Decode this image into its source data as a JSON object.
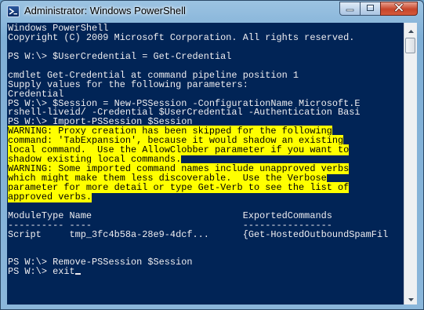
{
  "window": {
    "title": "Administrator: Windows PowerShell",
    "icon": "powershell-icon",
    "buttons": [
      "minimize-icon",
      "maximize-icon",
      "close-icon"
    ]
  },
  "colors": {
    "console_background": "#012456",
    "console_text": "#eeedf0",
    "warning_text": "#000000",
    "warning_background": "#ffff00",
    "close_button": "#c7452a"
  },
  "console": {
    "lines": [
      {
        "text": "Windows PowerShell",
        "style": "normal"
      },
      {
        "text": "Copyright (C) 2009 Microsoft Corporation. All rights reserved.",
        "style": "normal"
      },
      {
        "text": "",
        "style": "normal"
      },
      {
        "text": "PS W:\\> $UserCredential = Get-Credential",
        "style": "normal"
      },
      {
        "text": "",
        "style": "normal"
      },
      {
        "text": "cmdlet Get-Credential at command pipeline position 1",
        "style": "normal"
      },
      {
        "text": "Supply values for the following parameters:",
        "style": "normal"
      },
      {
        "text": "Credential",
        "style": "normal"
      },
      {
        "text": "PS W:\\> $Session = New-PSSession -ConfigurationName Microsoft.E",
        "style": "normal"
      },
      {
        "text": "rshell-liveid/ -Credential $UserCredential -Authentication Basi",
        "style": "normal"
      },
      {
        "text": "PS W:\\> Import-PSSession $Session",
        "style": "normal"
      },
      {
        "text": "WARNING: Proxy creation has been skipped for the following",
        "style": "warning"
      },
      {
        "text": "command: 'TabExpansion', because it would shadow an existing",
        "style": "warning"
      },
      {
        "text": "local command.  Use the AllowClobber parameter if you want to",
        "style": "warning"
      },
      {
        "text": "shadow existing local commands.",
        "style": "warning"
      },
      {
        "text": "WARNING: Some imported command names include unapproved verbs",
        "style": "warning"
      },
      {
        "text": "which might make them less discoverable.  Use the Verbose",
        "style": "warning"
      },
      {
        "text": "parameter for more detail or type Get-Verb to see the list of",
        "style": "warning"
      },
      {
        "text": "approved verbs.",
        "style": "warning"
      },
      {
        "text": "",
        "style": "normal"
      },
      {
        "text": "ModuleType Name                           ExportedCommands",
        "style": "normal"
      },
      {
        "text": "---------- ----                           ----------------",
        "style": "normal"
      },
      {
        "text": "Script     tmp_3fc4b58a-28e9-4dcf...      {Get-HostedOutboundSpamFil",
        "style": "normal"
      },
      {
        "text": "",
        "style": "normal"
      },
      {
        "text": "",
        "style": "normal"
      },
      {
        "text": "PS W:\\> Remove-PSSession $Session",
        "style": "normal"
      },
      {
        "text": "PS W:\\> exit",
        "style": "cursor"
      }
    ]
  }
}
